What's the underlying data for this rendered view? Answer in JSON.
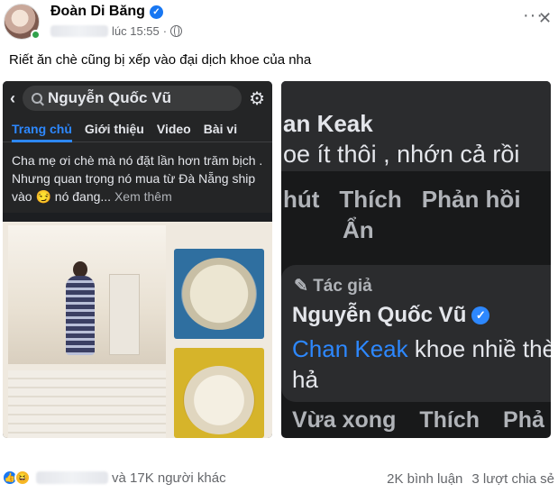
{
  "post": {
    "author": "Đoàn Di Băng",
    "timestamp": "lúc 15:55",
    "caption": "Riết ăn chè cũng bị xếp vào đại dịch khoe của nha"
  },
  "left_image": {
    "search_text": "Nguyễn Quốc Vũ",
    "tabs": [
      "Trang chủ",
      "Giới thiệu",
      "Video",
      "Bài vi"
    ],
    "post_text": "Cha mẹ ơi chè mà nó đặt lần hơn trăm bịch . Nhưng quan trọng nó mua từ Đà Nẵng ship vào 😏 nó đang...",
    "see_more": "Xem thêm"
  },
  "right_image": {
    "comment_name": "an Keak",
    "comment_text": "oe ít thôi , nhớn cả rồi",
    "actions1": [
      "hút",
      "Thích",
      "Phản hồi"
    ],
    "hide": "Ẩn",
    "author_badge": "✎ Tác giả",
    "reply_name": "Nguyễn Quốc Vũ",
    "reply_mention": "Chan Keak",
    "reply_text": " khoe nhiề thèm hả",
    "actions2": [
      "Vừa xong",
      "Thích",
      "Phả"
    ]
  },
  "footer": {
    "reactions_suffix": "và 17K người khác",
    "comments": "2K bình luận",
    "shares": "3 lượt chia sẻ"
  },
  "icons": [
    "verified-icon",
    "globe-icon",
    "more-icon",
    "close-icon",
    "back-icon",
    "search-icon",
    "gear-icon",
    "like-icon",
    "haha-icon"
  ]
}
